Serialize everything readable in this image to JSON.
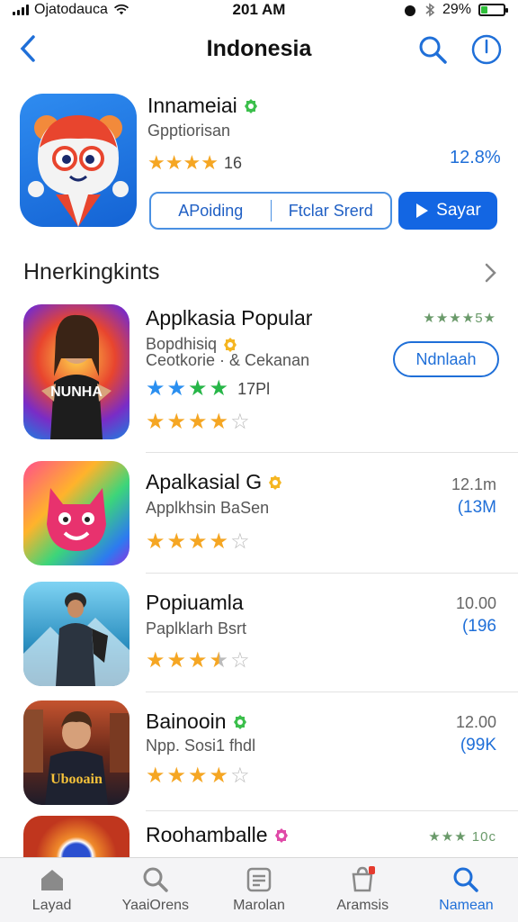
{
  "status": {
    "carrier": "Ojatodauca",
    "time": "201 AM",
    "battery": "29%",
    "battery_level": 0.29
  },
  "nav": {
    "title": "Indonesia"
  },
  "featured": {
    "name": "Innameiai",
    "subtitle": "Gpptiorisan",
    "rating_count": "16",
    "rating": 4,
    "price": "12.8%",
    "action_left": "APoiding",
    "action_right": "Ftclar Srerd",
    "play_label": "Sayar"
  },
  "section": {
    "title": "Hnerkingkints"
  },
  "apps": [
    {
      "name": "Applkasia Popular",
      "sub1": "Bopdhisiq",
      "sub2": "Ceotkorie · & Cekanan",
      "rating_count": "17Pl",
      "rating": 4,
      "meta_top": "★★★★5★",
      "button_label": "Ndnlaah",
      "icon_text": "NUNHA"
    },
    {
      "name": "Apalkasial G",
      "sub1": "Applkhsin BaSen",
      "rating": 4,
      "meta_top": "12.1m",
      "meta_bottom": "(13M"
    },
    {
      "name": "Popiuamla",
      "sub1": "Paplklarh Bsrt",
      "rating": 3.5,
      "meta_top": "10.00",
      "meta_bottom": "(196"
    },
    {
      "name": "Bainooin",
      "sub1": "Npp. Sosi1 fhdl",
      "rating": 4,
      "meta_top": "12.00",
      "meta_bottom": "(99K",
      "icon_text": "Ubooain"
    },
    {
      "name": "Roohamballe",
      "rating": 3,
      "meta_top": "★★★ 10c"
    }
  ],
  "tabs": [
    {
      "label": "Layad",
      "icon": "home-icon"
    },
    {
      "label": "YaaiOrens",
      "icon": "search-icon"
    },
    {
      "label": "Marolan",
      "icon": "list-icon"
    },
    {
      "label": "Aramsis",
      "icon": "bag-icon"
    },
    {
      "label": "Namean",
      "icon": "search-icon"
    }
  ],
  "colors": {
    "accent": "#1f6fd8",
    "star": "#f5a623",
    "play_button": "#1366e3"
  }
}
